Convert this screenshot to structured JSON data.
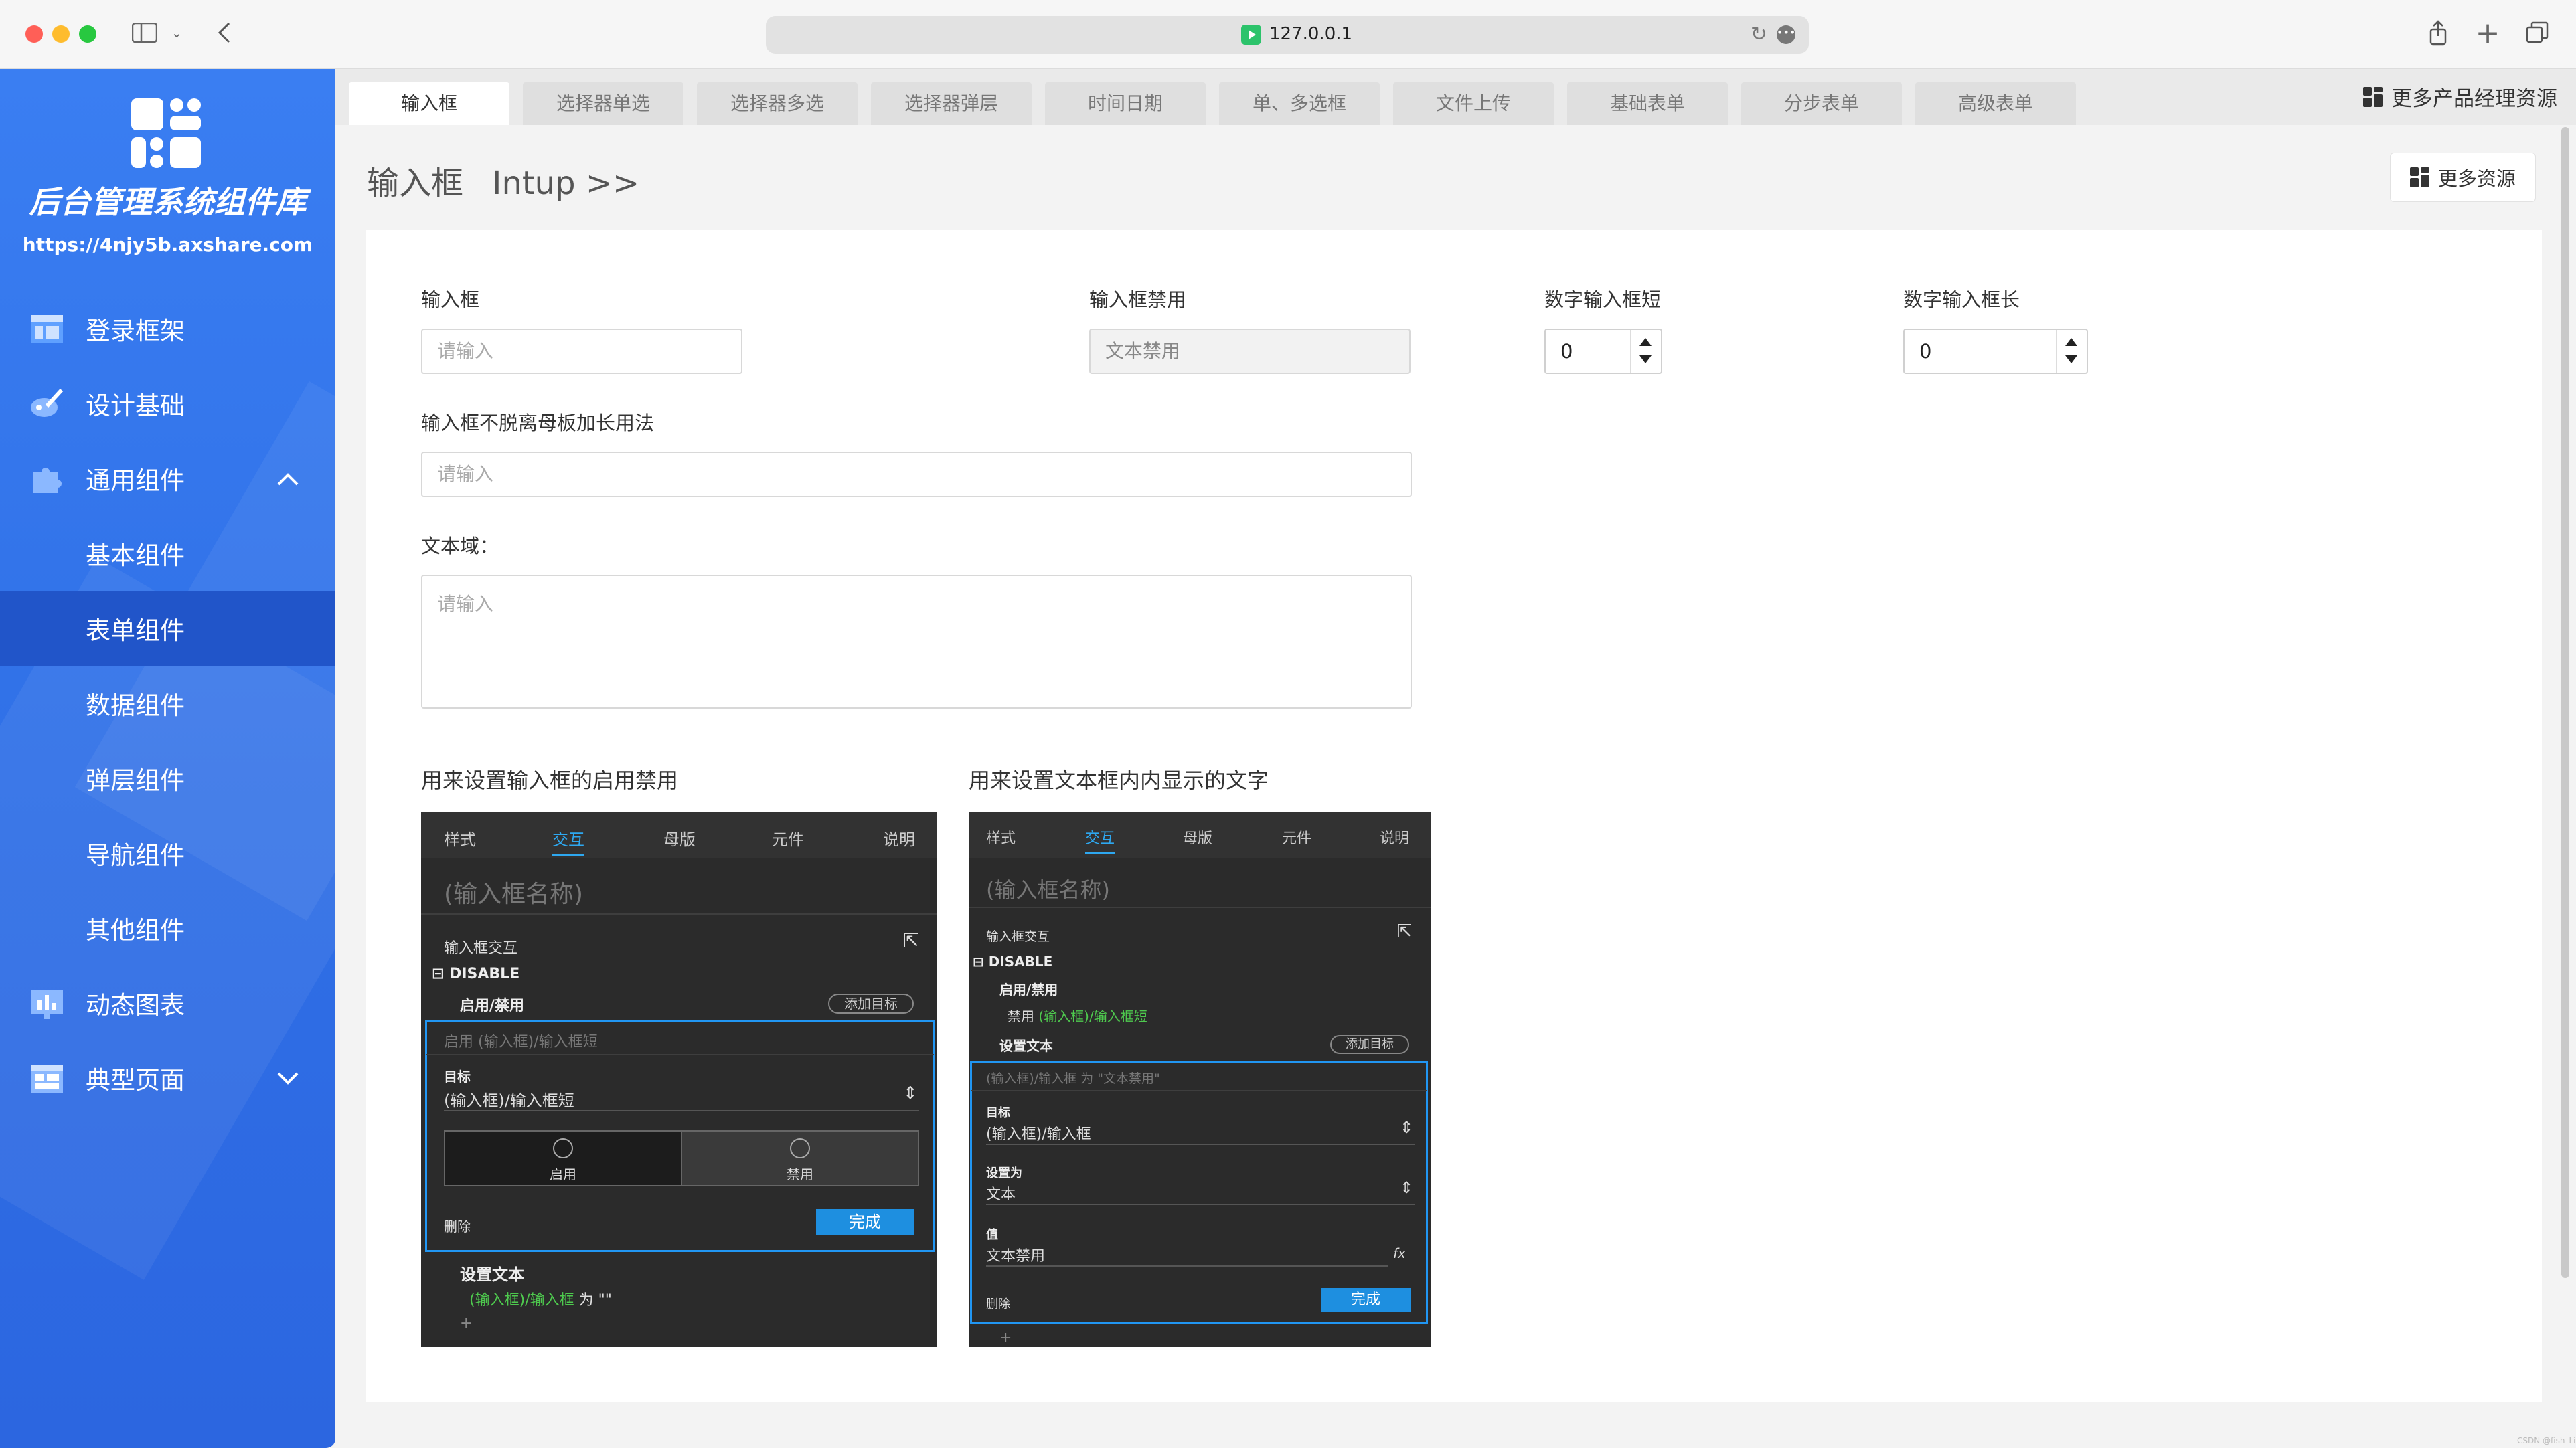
{
  "browser": {
    "url": "127.0.0.1"
  },
  "sidebar": {
    "title": "后台管理系统组件库",
    "url": "https://4njy5b.axshare.com",
    "items": [
      {
        "label": "登录框架",
        "icon": "layout-icon"
      },
      {
        "label": "设计基础",
        "icon": "brush-icon"
      },
      {
        "label": "通用组件",
        "icon": "puzzle-icon",
        "expanded": true
      },
      {
        "label": "基本组件"
      },
      {
        "label": "表单组件",
        "active": true
      },
      {
        "label": "数据组件"
      },
      {
        "label": "弹层组件"
      },
      {
        "label": "导航组件"
      },
      {
        "label": "其他组件"
      },
      {
        "label": "动态图表",
        "icon": "chart-icon"
      },
      {
        "label": "典型页面",
        "icon": "page-icon"
      }
    ]
  },
  "tabs": [
    "输入框",
    "选择器单选",
    "选择器多选",
    "选择器弹层",
    "时间日期",
    "单、多选框",
    "文件上传",
    "基础表单",
    "分步表单",
    "高级表单"
  ],
  "header": {
    "more_top": "更多产品经理资源",
    "title": "输入框",
    "subtitle": "Intup >>",
    "more_button": "更多资源"
  },
  "form": {
    "input_label": "输入框",
    "input_placeholder": "请输入",
    "disabled_label": "输入框禁用",
    "disabled_value": "文本禁用",
    "num_short_label": "数字输入框短",
    "num_short_value": "0",
    "num_long_label": "数字输入框长",
    "num_long_value": "0",
    "long_label": "输入框不脱离母板加长用法",
    "long_placeholder": "请输入",
    "textarea_label": "文本域：",
    "textarea_placeholder": "请输入"
  },
  "section1": {
    "title": "用来设置输入框的启用禁用",
    "tabs": [
      "样式",
      "交互",
      "母版",
      "元件",
      "说明"
    ],
    "name": "(输入框名称)",
    "interaction": "输入框交互",
    "event": "DISABLE",
    "case": "启用/禁用",
    "add_target": "添加目标",
    "action_hint": "启用 (输入框)/输入框短",
    "target_label": "目标",
    "target_value": "(输入框)/输入框短",
    "enable": "启用",
    "disable": "禁用",
    "delete": "删除",
    "done": "完成",
    "set_text": "设置文本",
    "set_text_target": "(输入框)/输入框",
    "set_text_rest": "为 \"\"",
    "plus": "+"
  },
  "section2": {
    "title": "用来设置文本框内内显示的文字",
    "tabs": [
      "样式",
      "交互",
      "母版",
      "元件",
      "说明"
    ],
    "name": "(输入框名称)",
    "interaction": "输入框交互",
    "event": "DISABLE",
    "case": "启用/禁用",
    "disable_prefix": "禁用",
    "disable_target": "(输入框)/输入框短",
    "set_text": "设置文本",
    "add_target": "添加目标",
    "action_hint": "(输入框)/输入框 为 \"文本禁用\"",
    "target_label": "目标",
    "target_value": "(输入框)/输入框",
    "set_as_label": "设置为",
    "set_as_value": "文本",
    "value_label": "值",
    "value_value": "文本禁用",
    "fx": "fx",
    "delete": "删除",
    "done": "完成",
    "plus": "+"
  },
  "watermark": "CSDN @fish_Li"
}
